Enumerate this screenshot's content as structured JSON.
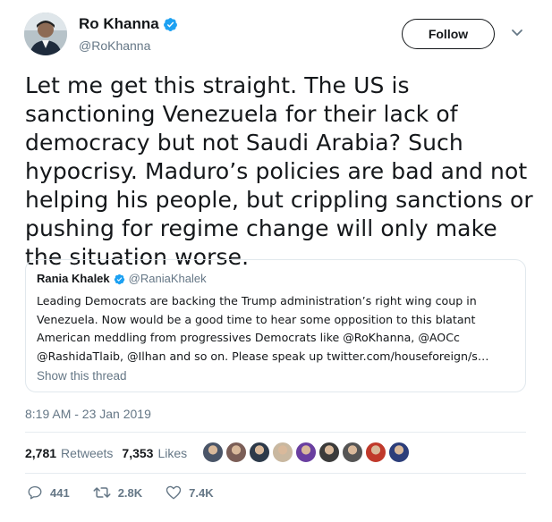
{
  "author": {
    "display_name": "Ro Khanna",
    "handle": "@RoKhanna",
    "verified": true
  },
  "follow_button": {
    "label": "Follow"
  },
  "tweet": {
    "text": "Let me get this straight. The US is sanctioning Venezuela for their lack of democracy but not Saudi Arabia? Such hypocrisy. Maduro’s policies are bad and not helping his people, but crippling sanctions or pushing for regime change will only make the situation worse.",
    "timestamp": "8:19 AM - 23 Jan 2019"
  },
  "quoted_tweet": {
    "display_name": "Rania Khalek",
    "handle": "@RaniaKhalek",
    "verified": true,
    "text": "Leading Democrats are backing the Trump administration’s right wing coup in Venezuela. Now would be a good time to hear some opposition to this blatant American meddling from progressives Democrats like @RoKhanna, @AOCc @RashidaTlaib, @Ilhan and so on. Please speak up twitter.com/houseforeign/s…",
    "show_thread": "Show this thread"
  },
  "stats": {
    "retweets_count": "2,781",
    "retweets_label": "Retweets",
    "likes_count": "7,353",
    "likes_label": "Likes"
  },
  "actions": {
    "replies": "441",
    "retweets": "2.8K",
    "likes": "7.4K"
  },
  "liker_avatars": [
    "#4a5568",
    "#7b5e57",
    "#2d3a4a",
    "#c9b8a0",
    "#6a3fa0",
    "#3b3b3b",
    "#555555",
    "#c0392b",
    "#2c3e7a"
  ],
  "colors": {
    "verified": "#1da1f2",
    "secondary_text": "#657786",
    "border": "#e1e8ed"
  }
}
